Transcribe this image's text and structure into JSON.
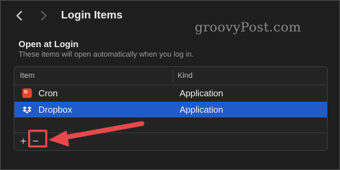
{
  "window": {
    "title": "Login Items",
    "watermark": "groovyPost.com"
  },
  "section": {
    "title": "Open at Login",
    "subtitle": "These items will open automatically when you log in."
  },
  "table": {
    "columns": [
      "Item",
      "Kind"
    ],
    "rows": [
      {
        "name": "Cron",
        "kind": "Application",
        "icon": "cron-app-icon",
        "selected": false
      },
      {
        "name": "Dropbox",
        "kind": "Application",
        "icon": "dropbox-app-icon",
        "selected": true
      }
    ]
  },
  "controls": {
    "add_label": "+",
    "remove_label": "−"
  },
  "colors": {
    "background": "#1e1e1e",
    "selection": "#1f5cc8",
    "annotation": "#e8484a",
    "cron_icon": "#e8472c"
  }
}
